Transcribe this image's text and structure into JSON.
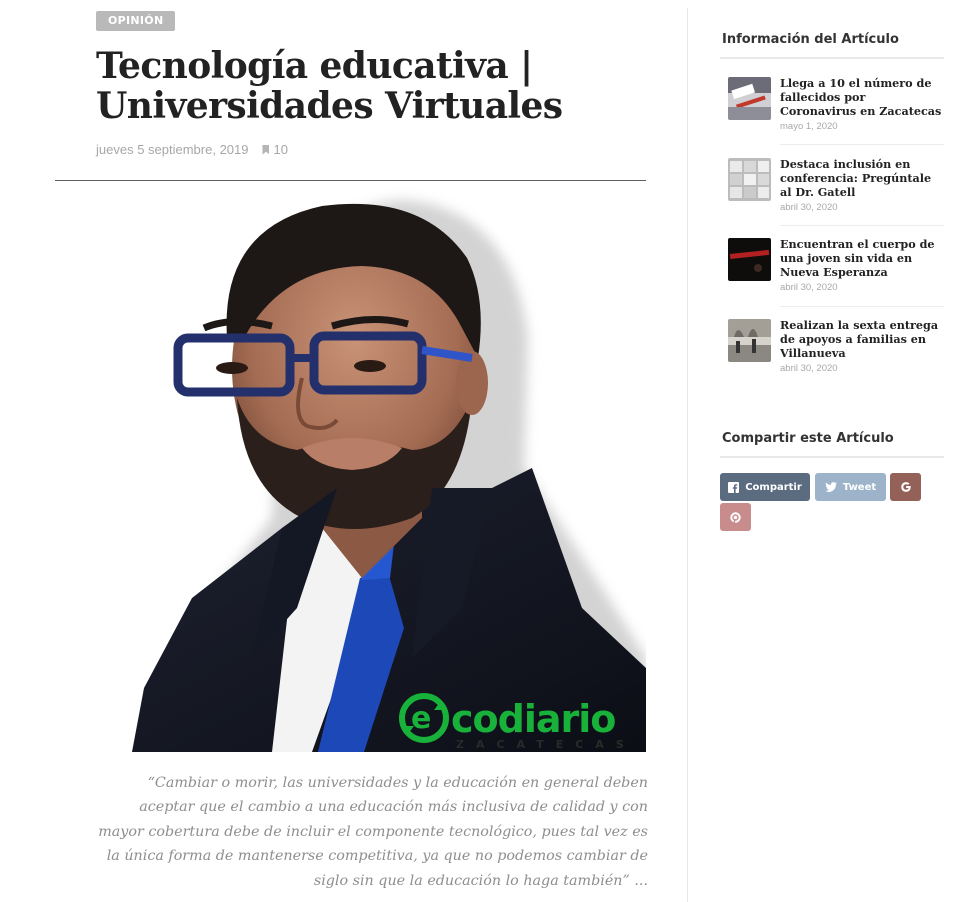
{
  "article": {
    "category": "OPINIÓN",
    "title": "Tecnología educativa | Universidades Virtuales",
    "date": "jueves 5 septiembre, 2019",
    "bookmark_count": "10",
    "quote": "“Cambiar o morir, las universidades y la educación en general deben aceptar que el cambio a una educación más inclusiva de calidad y con mayor cobertura debe de incluir el componente tecnológico, pues tal vez es la única forma de mantenerse competitiva, ya que no podemos cambiar de siglo sin que la educación lo haga también” ...",
    "logo": {
      "main": "codiario",
      "prefix": "e",
      "sub": "ZACATECAS"
    }
  },
  "sidebar": {
    "info_heading": "Información del Artículo",
    "posts": [
      {
        "title": "Llega a 10 el número de fallecidos por Coronavirus en Zacatecas",
        "date": "mayo 1, 2020"
      },
      {
        "title": "Destaca inclusión en conferencia: Pregúntale al Dr. Gatell",
        "date": "abril 30, 2020"
      },
      {
        "title": "Encuentran el cuerpo de una joven sin vida en Nueva Esperanza",
        "date": "abril 30, 2020"
      },
      {
        "title": "Realizan la sexta entrega de apoyos a familias en Villanueva",
        "date": "abril 30, 2020"
      }
    ],
    "share_heading": "Compartir este Artículo",
    "share": {
      "facebook": {
        "label": "Compartir",
        "icon": "facebook-icon",
        "color": "#5b6c80"
      },
      "twitter": {
        "label": "Tweet",
        "icon": "twitter-icon",
        "color": "#9cb3c9"
      },
      "google": {
        "label": "",
        "icon": "google-icon",
        "color": "#946158"
      },
      "pinterest": {
        "label": "",
        "icon": "pinterest-icon",
        "color": "#c98c8c"
      }
    }
  }
}
